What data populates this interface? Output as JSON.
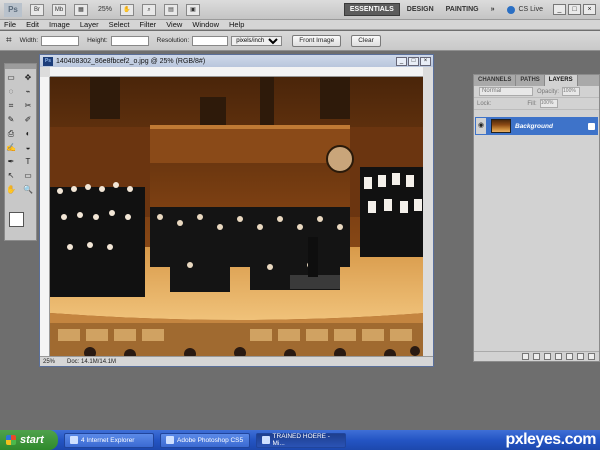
{
  "app": {
    "logo": "Ps",
    "zoom": "25%",
    "workspaces": [
      "ESSENTIALS",
      "DESIGN",
      "PAINTING"
    ],
    "active_workspace": "ESSENTIALS",
    "more": "»",
    "cs_live": "CS Live"
  },
  "menu": [
    "File",
    "Edit",
    "Image",
    "Layer",
    "Select",
    "Filter",
    "View",
    "Window",
    "Help"
  ],
  "options": {
    "width_label": "Width:",
    "height_label": "Height:",
    "resolution_label": "Resolution:",
    "resolution_unit": "pixels/inch",
    "front_image": "Front Image",
    "clear": "Clear"
  },
  "tools": [
    "▭",
    "✥",
    "◌",
    "⌁",
    "⌗",
    "✂",
    "✎",
    "✐",
    "⎙",
    "◐",
    "✍",
    "◒",
    "✒",
    "T",
    "↖",
    "▭",
    "✋",
    "🔍"
  ],
  "document": {
    "title": "140408302_86e8fbcef2_o.jpg @ 25% (RGB/8#)",
    "zoom": "25%",
    "doc_size": "Doc: 14.1M/14.1M"
  },
  "panel": {
    "tabs": [
      "CHANNELS",
      "PATHS",
      "LAYERS"
    ],
    "active_tab": "LAYERS",
    "blend_mode": "Normal",
    "opacity_label": "Opacity:",
    "opacity": "100%",
    "lock_label": "Lock:",
    "fill_label": "Fill:",
    "fill": "100%",
    "layer_name": "Background"
  },
  "taskbar": {
    "start": "start",
    "tasks": [
      "4 Internet Explorer",
      "Adobe Photoshop CS5",
      "TRAINED HOERE - Mi..."
    ],
    "brand": "pxleyes.com"
  }
}
